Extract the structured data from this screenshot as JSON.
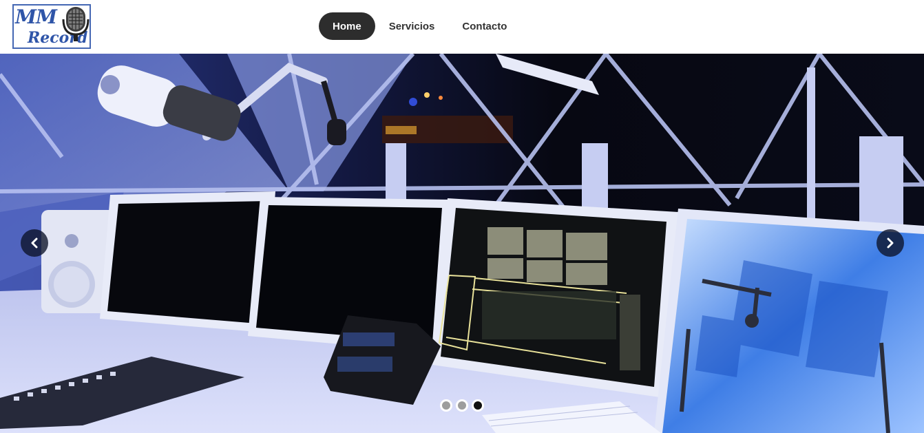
{
  "brand": {
    "logo_line1": "MM",
    "logo_line2": "Record",
    "logo_color": "#2f55a8"
  },
  "nav": {
    "items": [
      {
        "label": "Home",
        "active": true
      },
      {
        "label": "Servicios",
        "active": false
      },
      {
        "label": "Contacto",
        "active": false
      }
    ],
    "active_bg": "#2d2d2d"
  },
  "carousel": {
    "prev_icon": "chevron-left-icon",
    "next_icon": "chevron-right-icon",
    "slide_count": 3,
    "active_slide": 3
  }
}
